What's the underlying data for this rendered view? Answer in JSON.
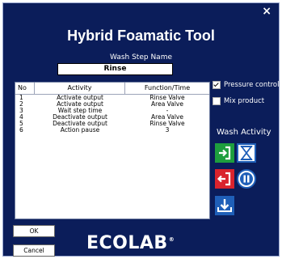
{
  "window": {
    "title": "Hybrid Foamatic Tool",
    "close_glyph": "×"
  },
  "wash_step": {
    "label": "Wash Step Name",
    "value": "Rinse"
  },
  "table": {
    "headers": [
      "No",
      "Activity",
      "Function/Time"
    ],
    "rows": [
      [
        "1",
        "Activate output",
        "Rinse Valve"
      ],
      [
        "2",
        "Activate output",
        "Area Valve"
      ],
      [
        "3",
        "Wait step time",
        "-"
      ],
      [
        "4",
        "Deactivate output",
        "Area Valve"
      ],
      [
        "5",
        "Deactivate output",
        "Rinse Valve"
      ],
      [
        "6",
        "Action pause",
        "3"
      ]
    ]
  },
  "options": {
    "pressure_control": {
      "label": "Pressure control",
      "checked": true
    },
    "mix_product": {
      "label": "Mix product",
      "checked": false
    }
  },
  "wash_activity": {
    "label": "Wash Activity"
  },
  "buttons": {
    "ok": "OK",
    "cancel": "Cancel"
  },
  "logo": {
    "text": "ECOLAB",
    "mark": "®"
  },
  "colors": {
    "background": "#0b1d5a",
    "green": "#1e9e3e",
    "red": "#d9232d",
    "blue": "#1f5fb8"
  }
}
